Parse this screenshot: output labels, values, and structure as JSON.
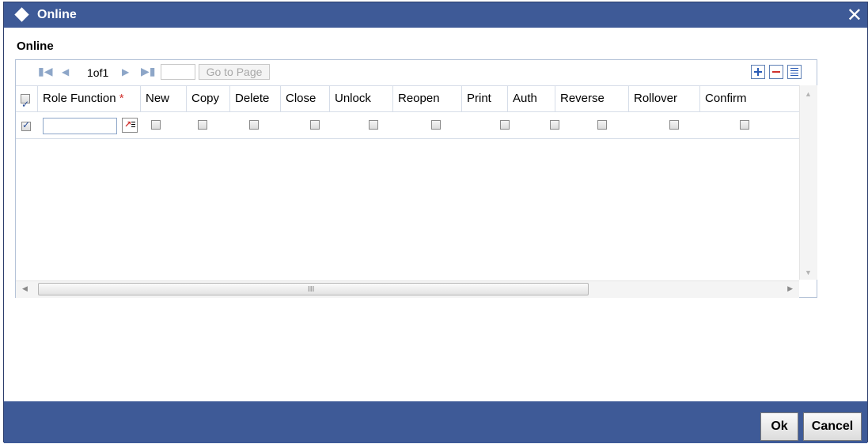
{
  "dialog": {
    "title": "Online"
  },
  "section": {
    "label": "Online"
  },
  "pager": {
    "first_icon": "first-page-icon",
    "prev_icon": "prev-page-icon",
    "next_icon": "next-page-icon",
    "last_icon": "last-page-icon",
    "page_text": "1of1",
    "page_input": "",
    "goto_label": "Go to Page"
  },
  "toolbar": {
    "add_icon": "plus-icon",
    "delete_icon": "minus-icon",
    "view_icon": "list-icon"
  },
  "table": {
    "headers": {
      "role_function": "Role Function",
      "required_mark": "*",
      "cols": [
        "New",
        "Copy",
        "Delete",
        "Close",
        "Unlock",
        "Reopen",
        "Print",
        "Auth",
        "Reverse",
        "Rollover",
        "Confirm"
      ]
    },
    "rows": [
      {
        "selected": true,
        "role_function": "",
        "flags": [
          false,
          false,
          false,
          false,
          false,
          false,
          false,
          false,
          false,
          false,
          false
        ]
      }
    ]
  },
  "scroll": {
    "grip": "III"
  },
  "footer": {
    "ok_label": "Ok",
    "cancel_label": "Cancel"
  },
  "colors": {
    "title_bar": "#3e5a97",
    "footer_bar": "#3e5a97",
    "required": "#d0312d"
  }
}
